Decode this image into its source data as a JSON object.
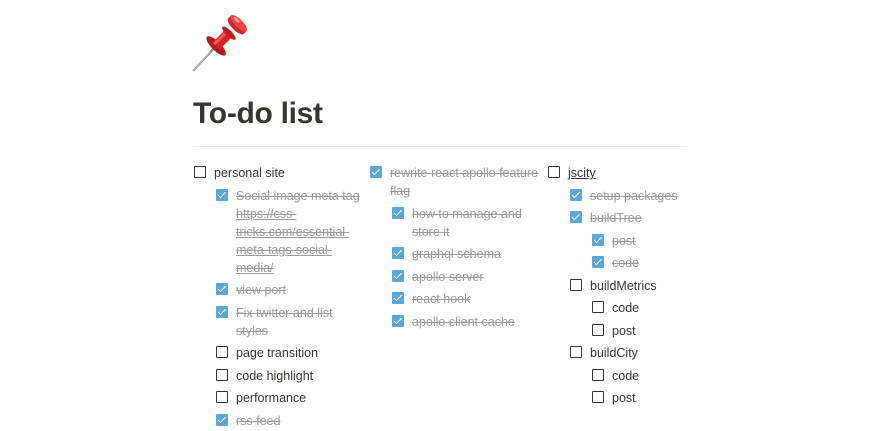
{
  "page": {
    "title": "To-do list",
    "icon": "pushpin-icon",
    "colors": {
      "checked": "#59a8d9",
      "text": "#37352f",
      "muted": "#9b9a97"
    }
  },
  "columns": [
    {
      "items": [
        {
          "label": "personal site",
          "checked": false,
          "level": 0
        },
        {
          "label": "Social image meta tag ",
          "link": "https://css-tricks.com/essential-meta-tags-social-media/",
          "checked": true,
          "level": 1
        },
        {
          "label": "view port",
          "checked": true,
          "level": 1
        },
        {
          "label": "Fix twitter and list styles",
          "checked": true,
          "level": 1
        },
        {
          "label": "page transition",
          "checked": false,
          "level": 1
        },
        {
          "label": "code highlight",
          "checked": false,
          "level": 1
        },
        {
          "label": "performance",
          "checked": false,
          "level": 1
        },
        {
          "label": "rss feed",
          "checked": true,
          "level": 1
        }
      ]
    },
    {
      "items": [
        {
          "label": "rewrite react apollo feature flag",
          "checked": true,
          "level": 0
        },
        {
          "label": "how to manage and store it",
          "checked": true,
          "level": 1
        },
        {
          "label": "graphql schema",
          "checked": true,
          "level": 1
        },
        {
          "label": "apollo server",
          "checked": true,
          "level": 1
        },
        {
          "label": "react hook",
          "checked": true,
          "level": 1
        },
        {
          "label": "apollo client cache",
          "checked": true,
          "level": 1
        }
      ]
    },
    {
      "items": [
        {
          "label": "jscity",
          "checked": false,
          "level": 0,
          "underline": true
        },
        {
          "label": "setup packages",
          "checked": true,
          "level": 1
        },
        {
          "label": "buildTree",
          "checked": true,
          "level": 1
        },
        {
          "label": "post",
          "checked": true,
          "level": 2
        },
        {
          "label": "code",
          "checked": true,
          "level": 2
        },
        {
          "label": "buildMetrics",
          "checked": false,
          "level": 1
        },
        {
          "label": "code",
          "checked": false,
          "level": 2
        },
        {
          "label": "post",
          "checked": false,
          "level": 2
        },
        {
          "label": "buildCity",
          "checked": false,
          "level": 1
        },
        {
          "label": "code",
          "checked": false,
          "level": 2
        },
        {
          "label": "post",
          "checked": false,
          "level": 2
        }
      ]
    }
  ]
}
